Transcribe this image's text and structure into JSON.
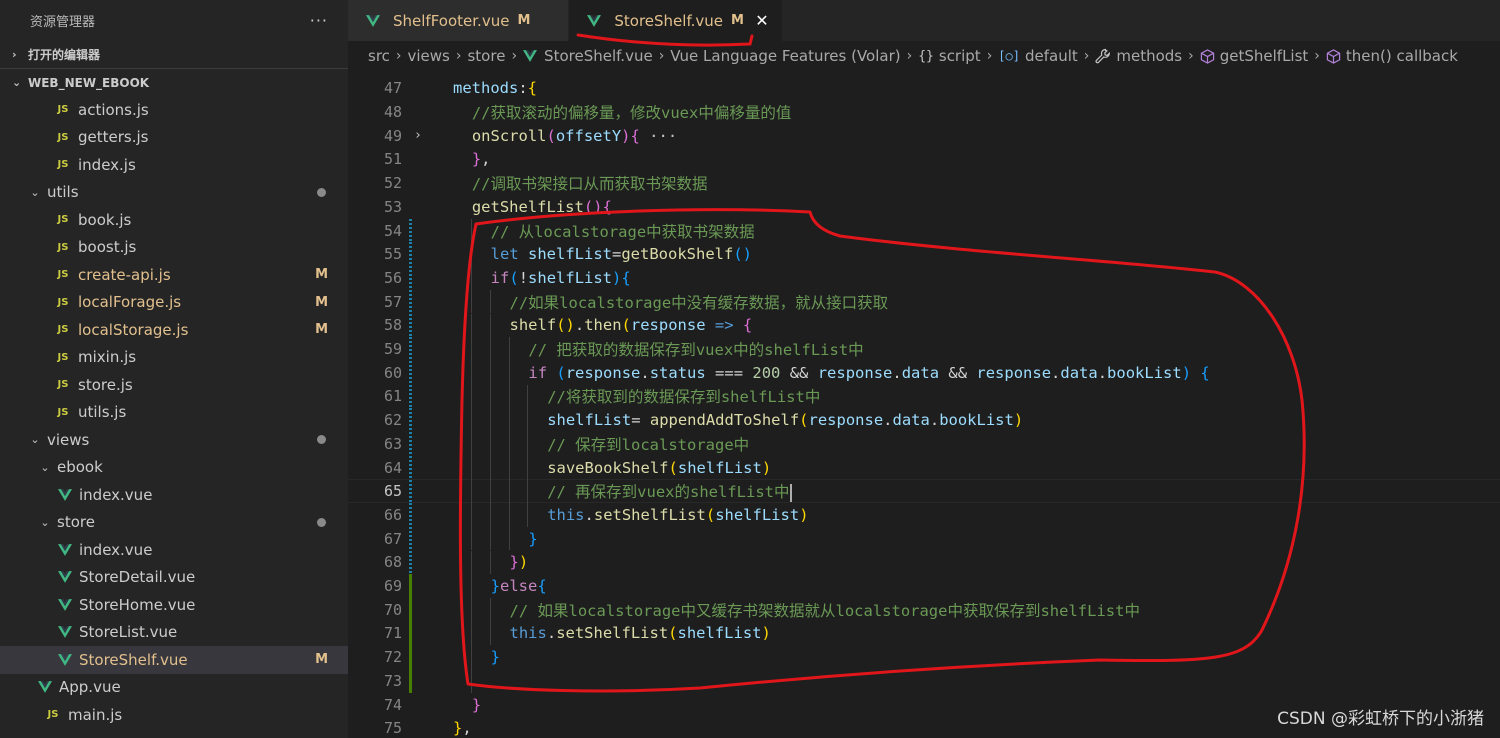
{
  "explorer": {
    "title": "资源管理器",
    "more": "···",
    "open_editors": "打开的编辑器",
    "project": "WEB_NEW_EBOOK",
    "items": [
      {
        "name": "actions.js",
        "type": "js",
        "depth": 3
      },
      {
        "name": "getters.js",
        "type": "js",
        "depth": 3
      },
      {
        "name": "index.js",
        "type": "js",
        "depth": 3
      },
      {
        "name": "utils",
        "type": "folder",
        "depth": 2,
        "dot": true
      },
      {
        "name": "book.js",
        "type": "js",
        "depth": 3
      },
      {
        "name": "boost.js",
        "type": "js",
        "depth": 3
      },
      {
        "name": "create-api.js",
        "type": "js",
        "depth": 3,
        "badge": "M"
      },
      {
        "name": "localForage.js",
        "type": "js",
        "depth": 3,
        "badge": "M"
      },
      {
        "name": "localStorage.js",
        "type": "js",
        "depth": 3,
        "badge": "M"
      },
      {
        "name": "mixin.js",
        "type": "js",
        "depth": 3
      },
      {
        "name": "store.js",
        "type": "js",
        "depth": 3
      },
      {
        "name": "utils.js",
        "type": "js",
        "depth": 3
      },
      {
        "name": "views",
        "type": "folder",
        "depth": 2,
        "dot": true
      },
      {
        "name": "ebook",
        "type": "folder",
        "depth": 3
      },
      {
        "name": "index.vue",
        "type": "vue",
        "depth": 4
      },
      {
        "name": "store",
        "type": "folder",
        "depth": 3,
        "dot": true
      },
      {
        "name": "index.vue",
        "type": "vue",
        "depth": 4
      },
      {
        "name": "StoreDetail.vue",
        "type": "vue",
        "depth": 4
      },
      {
        "name": "StoreHome.vue",
        "type": "vue",
        "depth": 4
      },
      {
        "name": "StoreList.vue",
        "type": "vue",
        "depth": 4
      },
      {
        "name": "StoreShelf.vue",
        "type": "vue",
        "depth": 4,
        "badge": "M",
        "selected": true
      },
      {
        "name": "App.vue",
        "type": "vue",
        "depth": 2
      },
      {
        "name": "main.js",
        "type": "js",
        "depth": 2
      }
    ]
  },
  "tabs": [
    {
      "name": "ShelfFooter.vue",
      "mod": "M",
      "active": false
    },
    {
      "name": "StoreShelf.vue",
      "mod": "M",
      "active": true,
      "close": "✕"
    }
  ],
  "breadcrumb": {
    "parts": [
      "src",
      "views",
      "store"
    ],
    "file": "StoreShelf.vue",
    "language": "Vue Language Features (Volar)",
    "script": "script",
    "default": "default",
    "methods": "methods",
    "fn": "getShelfList",
    "callback": "then() callback"
  },
  "editor": {
    "current_line": 65,
    "lines": [
      {
        "n": 47,
        "indent": 1,
        "tokens": [
          [
            "v",
            "methods"
          ],
          [
            "op",
            ":"
          ],
          [
            "b1",
            "{"
          ]
        ]
      },
      {
        "n": 48,
        "indent": 2,
        "tokens": [
          [
            "c",
            "//获取滚动的偏移量，修改vuex中偏移量的值"
          ]
        ]
      },
      {
        "n": 49,
        "indent": 2,
        "fold": "›",
        "tokens": [
          [
            "f",
            "onScroll"
          ],
          [
            "b2",
            "("
          ],
          [
            "p",
            "offsetY"
          ],
          [
            "b2",
            ")"
          ],
          [
            "b2",
            "{"
          ],
          [
            "fold-dots",
            " ···"
          ]
        ]
      },
      {
        "n": 51,
        "indent": 2,
        "tokens": [
          [
            "b2",
            "}"
          ],
          [
            "op",
            ","
          ]
        ]
      },
      {
        "n": 52,
        "indent": 2,
        "tokens": [
          [
            "c",
            "//调取书架接口从而获取书架数据"
          ]
        ]
      },
      {
        "n": 53,
        "indent": 2,
        "tokens": [
          [
            "f",
            "getShelfList"
          ],
          [
            "b2",
            "()"
          ],
          [
            "b2",
            "{"
          ]
        ]
      },
      {
        "n": 54,
        "indent": 3,
        "gutter": "mod",
        "tokens": [
          [
            "c",
            "// 从localstorage中获取书架数据"
          ]
        ]
      },
      {
        "n": 55,
        "indent": 3,
        "gutter": "mod",
        "tokens": [
          [
            "k",
            "let "
          ],
          [
            "v",
            "shelfList"
          ],
          [
            "op",
            "="
          ],
          [
            "f",
            "getBookShelf"
          ],
          [
            "b3",
            "()"
          ]
        ]
      },
      {
        "n": 56,
        "indent": 3,
        "gutter": "mod",
        "tokens": [
          [
            "ctl",
            "if"
          ],
          [
            "b3",
            "("
          ],
          [
            "op",
            "!"
          ],
          [
            "v",
            "shelfList"
          ],
          [
            "b3",
            ")"
          ],
          [
            "b3",
            "{"
          ]
        ]
      },
      {
        "n": 57,
        "indent": 4,
        "gutter": "mod",
        "tokens": [
          [
            "c",
            "//如果localstorage中没有缓存数据，就从接口获取"
          ]
        ]
      },
      {
        "n": 58,
        "indent": 4,
        "gutter": "mod",
        "tokens": [
          [
            "f",
            "shelf"
          ],
          [
            "b1",
            "()"
          ],
          [
            "op",
            "."
          ],
          [
            "f",
            "then"
          ],
          [
            "b1",
            "("
          ],
          [
            "v",
            "response"
          ],
          [
            "k",
            " =>"
          ],
          [
            "op",
            " "
          ],
          [
            "b2",
            "{"
          ]
        ]
      },
      {
        "n": 59,
        "indent": 5,
        "gutter": "mod",
        "tokens": [
          [
            "c",
            "// 把获取的数据保存到vuex中的shelfList中"
          ]
        ]
      },
      {
        "n": 60,
        "indent": 5,
        "gutter": "mod",
        "tokens": [
          [
            "ctl",
            "if"
          ],
          [
            "op",
            " "
          ],
          [
            "b3",
            "("
          ],
          [
            "v",
            "response"
          ],
          [
            "op",
            "."
          ],
          [
            "v",
            "status"
          ],
          [
            "op",
            " === "
          ],
          [
            "n",
            "200"
          ],
          [
            "op",
            " && "
          ],
          [
            "v",
            "response"
          ],
          [
            "op",
            "."
          ],
          [
            "v",
            "data"
          ],
          [
            "op",
            " && "
          ],
          [
            "v",
            "response"
          ],
          [
            "op",
            "."
          ],
          [
            "v",
            "data"
          ],
          [
            "op",
            "."
          ],
          [
            "v",
            "bookList"
          ],
          [
            "b3",
            ")"
          ],
          [
            "op",
            " "
          ],
          [
            "b3",
            "{"
          ]
        ]
      },
      {
        "n": 61,
        "indent": 6,
        "gutter": "mod",
        "tokens": [
          [
            "c",
            "//将获取到的数据保存到shelfList中"
          ]
        ]
      },
      {
        "n": 62,
        "indent": 6,
        "gutter": "mod",
        "tokens": [
          [
            "v",
            "shelfList"
          ],
          [
            "op",
            "= "
          ],
          [
            "f",
            "appendAddToShelf"
          ],
          [
            "b1",
            "("
          ],
          [
            "v",
            "response"
          ],
          [
            "op",
            "."
          ],
          [
            "v",
            "data"
          ],
          [
            "op",
            "."
          ],
          [
            "v",
            "bookList"
          ],
          [
            "b1",
            ")"
          ]
        ]
      },
      {
        "n": 63,
        "indent": 6,
        "gutter": "mod",
        "tokens": [
          [
            "c",
            "// 保存到localstorage中"
          ]
        ]
      },
      {
        "n": 64,
        "indent": 6,
        "gutter": "mod",
        "tokens": [
          [
            "f",
            "saveBookShelf"
          ],
          [
            "b1",
            "("
          ],
          [
            "v",
            "shelfList"
          ],
          [
            "b1",
            ")"
          ]
        ]
      },
      {
        "n": 65,
        "indent": 6,
        "gutter": "mod",
        "cursor": true,
        "tokens": [
          [
            "c",
            "// 再保存到vuex的shelfList中"
          ]
        ]
      },
      {
        "n": 66,
        "indent": 6,
        "gutter": "mod",
        "tokens": [
          [
            "k",
            "this"
          ],
          [
            "op",
            "."
          ],
          [
            "f",
            "setShelfList"
          ],
          [
            "b1",
            "("
          ],
          [
            "v",
            "shelfList"
          ],
          [
            "b1",
            ")"
          ]
        ]
      },
      {
        "n": 67,
        "indent": 5,
        "gutter": "mod",
        "tokens": [
          [
            "b3",
            "}"
          ]
        ]
      },
      {
        "n": 68,
        "indent": 4,
        "gutter": "mod",
        "tokens": [
          [
            "b2",
            "}"
          ],
          [
            "b1",
            ")"
          ]
        ]
      },
      {
        "n": 69,
        "indent": 3,
        "gutter": "add",
        "tokens": [
          [
            "b3",
            "}"
          ],
          [
            "ctl",
            "else"
          ],
          [
            "b3",
            "{"
          ]
        ]
      },
      {
        "n": 70,
        "indent": 4,
        "gutter": "add",
        "tokens": [
          [
            "c",
            "// 如果localstorage中又缓存书架数据就从localstorage中获取保存到shelfList中"
          ]
        ]
      },
      {
        "n": 71,
        "indent": 4,
        "gutter": "add",
        "tokens": [
          [
            "k",
            "this"
          ],
          [
            "op",
            "."
          ],
          [
            "f",
            "setShelfList"
          ],
          [
            "b1",
            "("
          ],
          [
            "v",
            "shelfList"
          ],
          [
            "b1",
            ")"
          ]
        ]
      },
      {
        "n": 72,
        "indent": 3,
        "gutter": "add",
        "tokens": [
          [
            "b3",
            "}"
          ]
        ]
      },
      {
        "n": 73,
        "indent": 3,
        "gutter": "add",
        "tokens": []
      },
      {
        "n": 74,
        "indent": 2,
        "tokens": [
          [
            "b2",
            "}"
          ]
        ]
      },
      {
        "n": 75,
        "indent": 1,
        "tokens": [
          [
            "b1",
            "}"
          ],
          [
            "op",
            ","
          ]
        ]
      }
    ]
  },
  "watermark": "CSDN @彩虹桥下的小浙猪",
  "colors": {
    "annotation": "#e0161b",
    "modified": "#e2c08d",
    "vue_green": "#41b883"
  }
}
